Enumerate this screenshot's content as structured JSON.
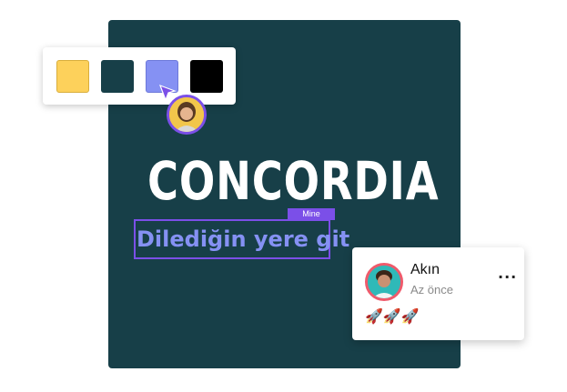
{
  "palette": {
    "swatches": [
      {
        "name": "yellow",
        "color": "#fdd15b"
      },
      {
        "name": "dark-teal",
        "color": "#173f48"
      },
      {
        "name": "periwinkle",
        "color": "#8591f3",
        "selected": true
      },
      {
        "name": "black",
        "color": "#000000"
      }
    ]
  },
  "canvas": {
    "background": "#173f48",
    "logo_text": "CONCORDIA",
    "selected_text": "Dilediğin yere git",
    "owner_tag": "Mine",
    "selection_color": "#7b4fe8"
  },
  "presence": {
    "avatar_icon": "user-avatar-woman",
    "cursor_icon": "pointer-cursor-icon"
  },
  "comment": {
    "author": "Akın",
    "time": "Az önce",
    "more_icon": "more-horizontal-icon",
    "more_label": "...",
    "body": "🚀🚀🚀"
  }
}
